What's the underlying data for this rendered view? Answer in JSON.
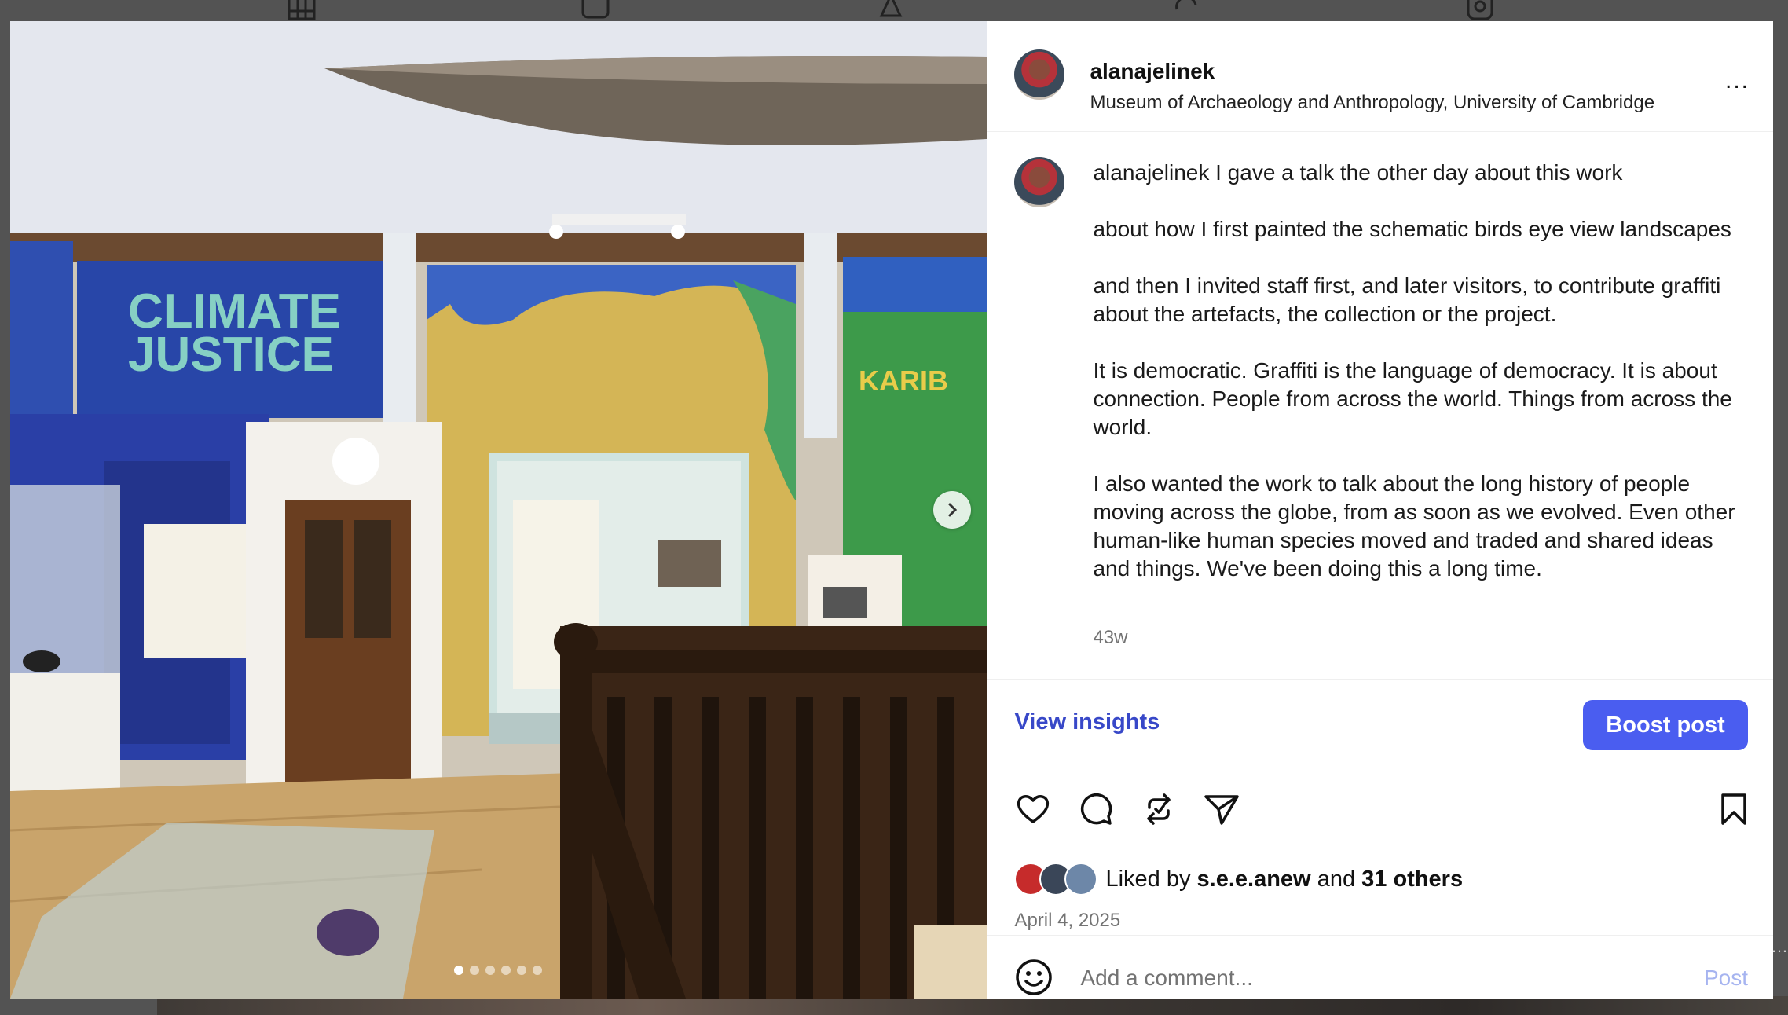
{
  "post": {
    "username": "alanajelinek",
    "location": "Museum of Archaeology and Anthropology, University of Cambridge",
    "more_label": "...",
    "caption_user": "alanajelinek",
    "caption_paragraphs": [
      "I gave a talk the other day about this work",
      "about how I first painted the schematic birds eye view landscapes",
      "and then I invited staff first, and later visitors, to contribute graffiti about the artefacts, the collection or the project.",
      "It is democratic. Graffiti is the language of democracy. It is about connection. People from across the world. Things from across the world.",
      "I also wanted the work to talk about the long history of people moving across the globe, from as soon as we evolved. Even other human-like human species moved and traded and shared ideas and things. We've been doing this a long time."
    ],
    "time_ago": "43w",
    "date": "April 4, 2025"
  },
  "insights": {
    "view_label": "View insights",
    "boost_label": "Boost post"
  },
  "likes": {
    "prefix": "Liked by",
    "first_user": "s.e.e.anew",
    "conjunction": "and",
    "others": "31 others"
  },
  "comment": {
    "placeholder": "Add a comment...",
    "post_label": "Post"
  },
  "carousel": {
    "count": 6,
    "active_index": 0
  },
  "colors": {
    "boost": "#4a5df0",
    "link": "#3848c8",
    "post_disabled": "#a6b4f0"
  },
  "icons": [
    "grid-icon",
    "reels-icon",
    "tagged-icon",
    "repost-icon",
    "profile-icon",
    "heart-icon",
    "comment-icon",
    "share-icon",
    "send-icon",
    "bookmark-icon",
    "emoji-icon",
    "chevron-right-icon",
    "more-icon"
  ]
}
